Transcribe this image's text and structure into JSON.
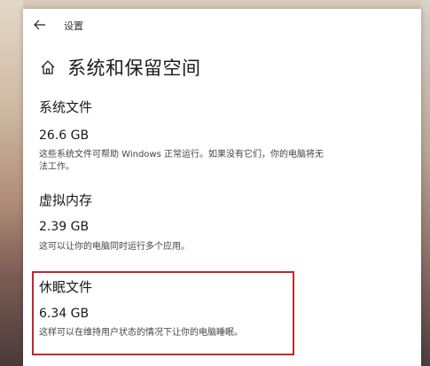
{
  "window": {
    "back_icon": "back-arrow-icon",
    "title": "设置"
  },
  "page": {
    "home_icon": "home-icon",
    "title": "系统和保留空间"
  },
  "sections": [
    {
      "title": "系统文件",
      "size": "26.6 GB",
      "desc_line1": "这些系统文件可帮助 Windows 正常运行。如果没有它们，你的电脑将无",
      "desc_line2": "法工作。"
    },
    {
      "title": "虚拟内存",
      "size": "2.39 GB",
      "desc_line1": "这可以让你的电脑同时运行多个应用。"
    },
    {
      "title": "休眠文件",
      "size": "6.34 GB",
      "desc_line1": "这样可以在维持用户状态的情况下让你的电脑睡眠。"
    }
  ],
  "colors": {
    "highlight_border": "#c0282d"
  }
}
